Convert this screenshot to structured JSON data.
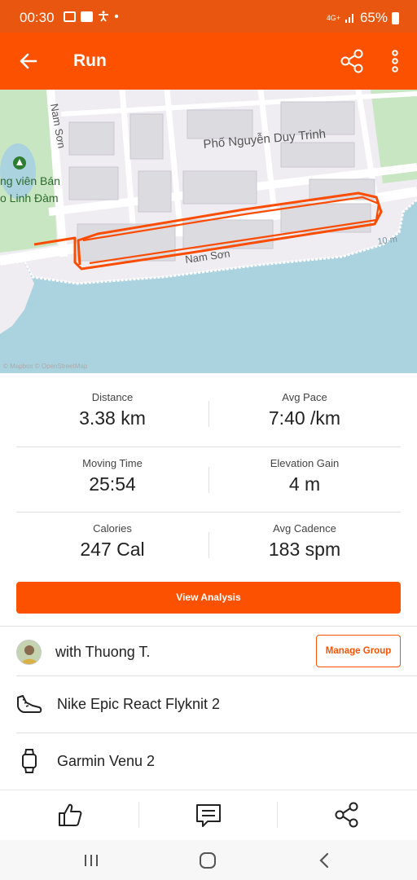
{
  "status_bar": {
    "time": "00:30",
    "network": "4G+",
    "battery": "65%"
  },
  "app_bar": {
    "title": "Run",
    "icons": [
      "back-arrow-icon",
      "share-icon",
      "more-vertical-icon"
    ]
  },
  "map": {
    "labels": {
      "street_top": "Phố Nguyễn Duy Trinh",
      "street_left": "Nam Sơn",
      "street_bottom": "Nam Sơn",
      "park_line1": "ng viên Bán",
      "park_line2": "o Linh Đàm",
      "contour": "10 m"
    },
    "attribution": "© Mapbox © OpenStreetMap",
    "colors": {
      "water": "#aad3df",
      "park": "#c8e6c1",
      "route": "#fc4c02",
      "block": "#d9d9de"
    }
  },
  "stats": {
    "rows": [
      [
        {
          "label": "Distance",
          "value": "3.38 km"
        },
        {
          "label": "Avg Pace",
          "value": "7:40 /km"
        }
      ],
      [
        {
          "label": "Moving Time",
          "value": "25:54"
        },
        {
          "label": "Elevation Gain",
          "value": "4 m"
        }
      ],
      [
        {
          "label": "Calories",
          "value": "247 Cal"
        },
        {
          "label": "Avg Cadence",
          "value": "183 spm"
        }
      ]
    ]
  },
  "view_analysis_label": "View Analysis",
  "group": {
    "text": "with Thuong T.",
    "manage_label": "Manage Group"
  },
  "gear": {
    "shoes": "Nike Epic React Flyknit 2",
    "device": "Garmin Venu 2"
  },
  "actions": [
    "thumbs-up-icon",
    "comment-icon",
    "share-icon"
  ],
  "nav": [
    "recent-apps-icon",
    "home-icon",
    "back-icon"
  ],
  "accent_color": "#fc5200"
}
